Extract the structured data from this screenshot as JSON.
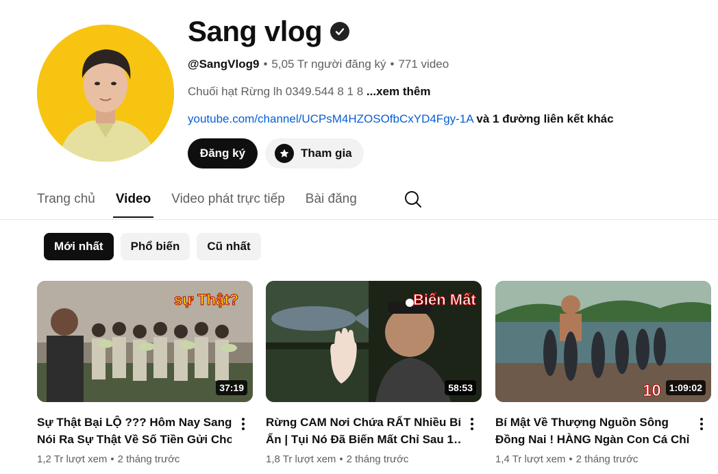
{
  "channel": {
    "name": "Sang vlog",
    "handle": "@SangVlog9",
    "subscribers": "5,05 Tr người đăng ký",
    "video_count": "771 video",
    "description": "Chuối hạt Rừng lh 0349.544 8 1 8",
    "more_label": "...xem thêm",
    "link_url": "youtube.com/channel/UCPsM4HZOSOfbCxYD4Fgy-1A",
    "link_extra": "và 1 đường liên kết khác",
    "subscribe_label": "Đăng ký",
    "join_label": "Tham gia"
  },
  "tabs": [
    {
      "label": "Trang chủ",
      "active": false
    },
    {
      "label": "Video",
      "active": true
    },
    {
      "label": "Video phát trực tiếp",
      "active": false
    },
    {
      "label": "Bài đăng",
      "active": false
    }
  ],
  "chips": [
    {
      "label": "Mới nhất",
      "active": true
    },
    {
      "label": "Phổ biến",
      "active": false
    },
    {
      "label": "Cũ nhất",
      "active": false
    }
  ],
  "videos": [
    {
      "title_line1": "Sự Thật Bại LỘ ??? Hôm Nay Sang",
      "title_line2": "Nói Ra Sự Thật Về Số Tiền Gửi Cho…",
      "thumb_text": "sự Thật?",
      "duration": "37:19",
      "views": "1,2 Tr lượt xem",
      "age": "2 tháng trước"
    },
    {
      "title_line1": "Rừng CAM Nơi Chứa RẤT Nhiều Bí",
      "title_line2": "Ẩn | Tụi Nó Đã Biến Mất Chỉ Sau 1…",
      "thumb_text": "Biến Mất",
      "duration": "58:53",
      "views": "1,8 Tr lượt xem",
      "age": "2 tháng trước"
    },
    {
      "title_line1": "Bí Mật Về Thượng Nguồn Sông",
      "title_line2": "Đồng Nai ! HÀNG Ngàn Con Cá Chỉ…",
      "thumb_text": "10",
      "duration": "1:09:02",
      "views": "1,4 Tr lượt xem",
      "age": "2 tháng trước"
    }
  ],
  "colors": {
    "avatar_bg": "#f7c411",
    "link": "#065fd4",
    "text_primary": "#0f0f0f",
    "text_secondary": "#606060",
    "chip_bg": "#f2f2f2"
  },
  "icons": {
    "verified": "check-circle",
    "join": "star",
    "search": "magnifier",
    "more": "vertical-dots"
  }
}
